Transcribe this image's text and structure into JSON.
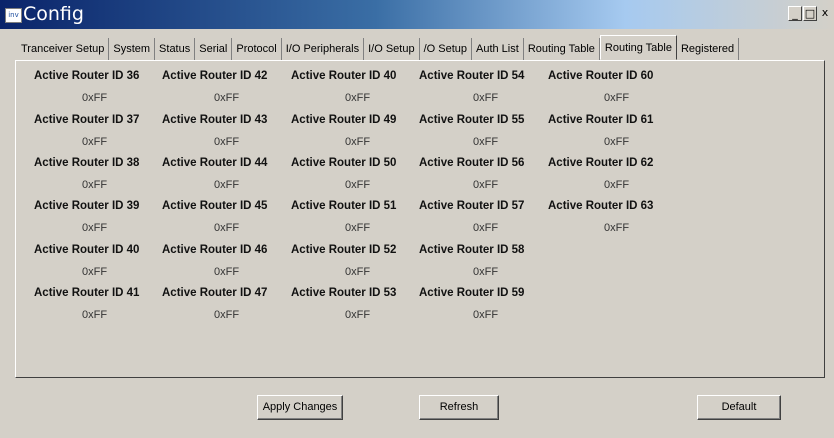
{
  "window": {
    "title": "Config",
    "icon_text": "inv",
    "controls": {
      "minimize": "_",
      "maximize": "□",
      "close": "x"
    }
  },
  "tabs": [
    {
      "label": "Tranceiver Setup",
      "active": false
    },
    {
      "label": "System",
      "active": false
    },
    {
      "label": "Status",
      "active": false
    },
    {
      "label": "Serial",
      "active": false
    },
    {
      "label": "Protocol",
      "active": false
    },
    {
      "label": "I/O Peripherals",
      "active": false
    },
    {
      "label": "I/O Setup",
      "active": false
    },
    {
      "label": "/O Setup",
      "active": false
    },
    {
      "label": "Auth List",
      "active": false
    },
    {
      "label": "Routing Table",
      "active": false
    },
    {
      "label": "Routing Table",
      "active": true
    },
    {
      "label": "Registered",
      "active": false
    }
  ],
  "routing": {
    "columns": [
      [
        {
          "label": "Active Router ID 36",
          "value": "0xFF"
        },
        {
          "label": "Active Router ID 37",
          "value": "0xFF"
        },
        {
          "label": "Active Router ID 38",
          "value": "0xFF"
        },
        {
          "label": "Active Router ID 39",
          "value": "0xFF"
        },
        {
          "label": "Active Router ID 40",
          "value": "0xFF"
        },
        {
          "label": "Active Router ID 41",
          "value": "0xFF"
        }
      ],
      [
        {
          "label": "Active Router ID 42",
          "value": "0xFF"
        },
        {
          "label": "Active Router ID 43",
          "value": "0xFF"
        },
        {
          "label": "Active Router ID 44",
          "value": "0xFF"
        },
        {
          "label": "Active Router ID 45",
          "value": "0xFF"
        },
        {
          "label": "Active Router ID 46",
          "value": "0xFF"
        },
        {
          "label": "Active Router ID 47",
          "value": "0xFF"
        }
      ],
      [
        {
          "label": "Active Router ID 40",
          "value": "0xFF"
        },
        {
          "label": "Active Router ID 49",
          "value": "0xFF"
        },
        {
          "label": "Active Router ID 50",
          "value": "0xFF"
        },
        {
          "label": "Active Router ID 51",
          "value": "0xFF"
        },
        {
          "label": "Active Router ID 52",
          "value": "0xFF"
        },
        {
          "label": "Active Router ID 53",
          "value": "0xFF"
        }
      ],
      [
        {
          "label": "Active Router ID 54",
          "value": "0xFF"
        },
        {
          "label": "Active Router ID 55",
          "value": "0xFF"
        },
        {
          "label": "Active Router ID 56",
          "value": "0xFF"
        },
        {
          "label": "Active Router ID 57",
          "value": "0xFF"
        },
        {
          "label": "Active Router ID 58",
          "value": "0xFF"
        },
        {
          "label": "Active Router ID 59",
          "value": "0xFF"
        }
      ],
      [
        {
          "label": "Active Router ID 60",
          "value": "0xFF"
        },
        {
          "label": "Active Router ID 61",
          "value": "0xFF"
        },
        {
          "label": "Active Router ID 62",
          "value": "0xFF"
        },
        {
          "label": "Active Router ID 63",
          "value": "0xFF"
        }
      ]
    ]
  },
  "buttons": {
    "apply": "Apply Changes",
    "refresh": "Refresh",
    "default": "Default"
  }
}
